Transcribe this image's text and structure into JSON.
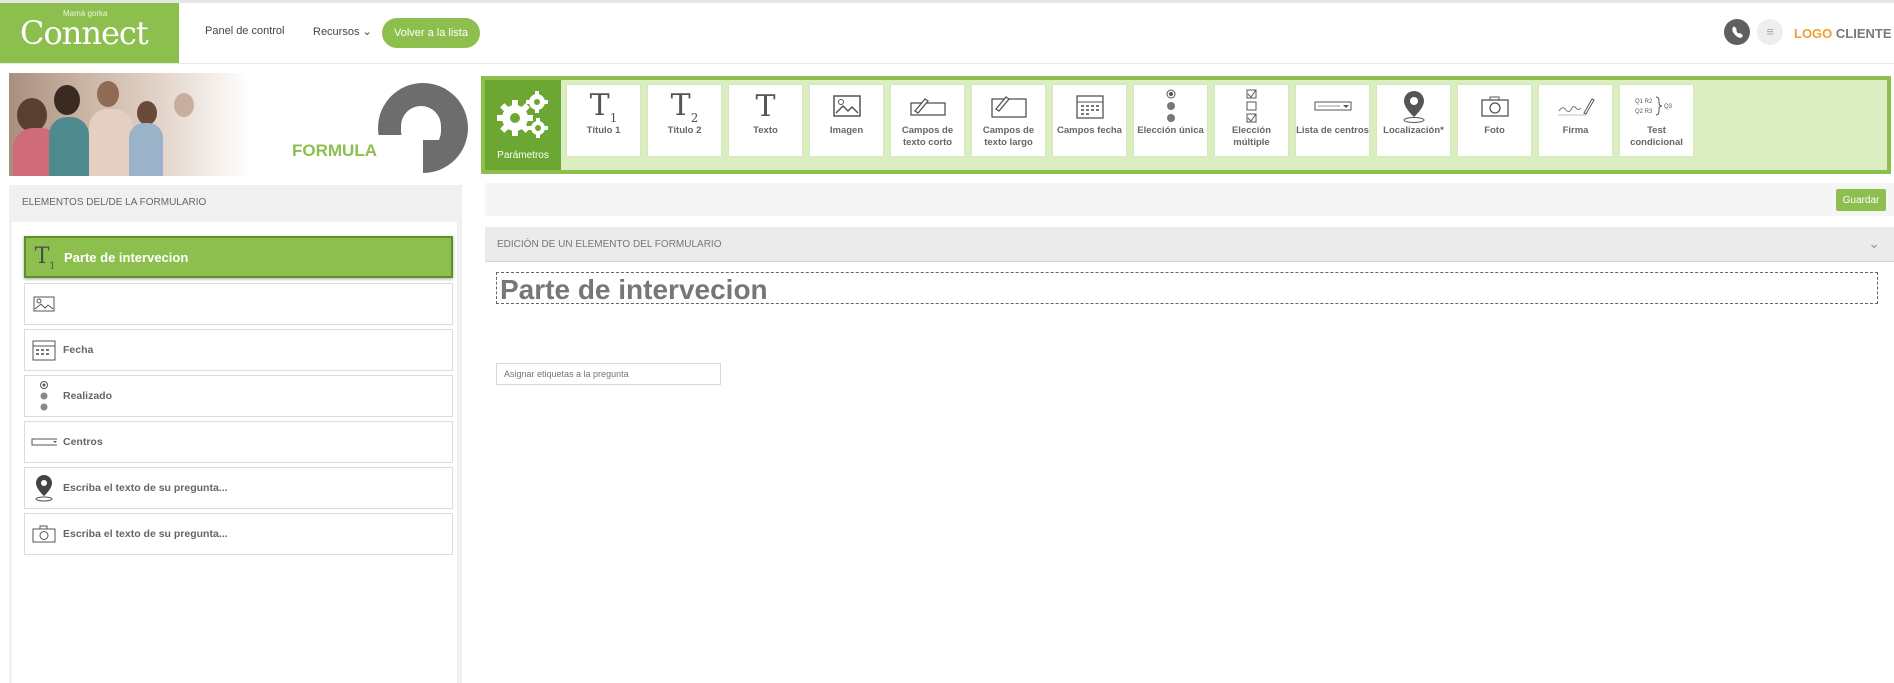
{
  "header": {
    "logo_small": "Mamá gorka",
    "logo_text": "Connect",
    "nav": {
      "dashboard": "Panel de control",
      "resources": "Recursos ⌄"
    },
    "back_button": "Volver a la lista",
    "client_logo": "LOGO CLIENTE"
  },
  "banner": {
    "title": "FORMULARIO"
  },
  "toolbar": {
    "params_label": "Parámetros",
    "tools": [
      {
        "label": "Título 1",
        "icon": "title1-icon"
      },
      {
        "label": "Título 2",
        "icon": "title2-icon"
      },
      {
        "label": "Texto",
        "icon": "text-icon"
      },
      {
        "label": "Imagen",
        "icon": "image-icon"
      },
      {
        "label": "Campos de texto corto",
        "icon": "short-text-icon"
      },
      {
        "label": "Campos de texto largo",
        "icon": "long-text-icon"
      },
      {
        "label": "Campos fecha",
        "icon": "calendar-icon"
      },
      {
        "label": "Elección única",
        "icon": "radio-icon"
      },
      {
        "label": "Elección múltiple",
        "icon": "checkbox-icon"
      },
      {
        "label": "Lista de centros",
        "icon": "dropdown-icon"
      },
      {
        "label": "Localización*",
        "icon": "location-pin-icon"
      },
      {
        "label": "Foto",
        "icon": "camera-icon"
      },
      {
        "label": "Firma",
        "icon": "signature-icon"
      },
      {
        "label": "Test condicional",
        "icon": "conditional-icon"
      }
    ]
  },
  "left": {
    "title": "ELEMENTOS DEL/DE LA FORMULARIO",
    "elements": [
      {
        "label": "Parte de intervecion",
        "icon": "title1-icon"
      },
      {
        "label": "",
        "icon": "image-icon"
      },
      {
        "label": "Fecha",
        "icon": "calendar-icon"
      },
      {
        "label": "Realizado",
        "icon": "radio-icon"
      },
      {
        "label": "Centros",
        "icon": "dropdown-icon"
      },
      {
        "label": "Escriba el texto de su pregunta...",
        "icon": "location-pin-icon"
      },
      {
        "label": "Escriba el texto de su pregunta...",
        "icon": "camera-icon"
      }
    ]
  },
  "right": {
    "save": "Guardar",
    "edit_title": "EDICIÓN DE UN ELEMENTO DEL FORMULARIO",
    "element_title": "Parte de intervecion",
    "tag_placeholder": "Asignar etiquetas a la pregunta"
  },
  "colors": {
    "brand_green": "#8cbf4e",
    "dark_green": "#6da733",
    "toolbar_bg": "#dbeec1"
  }
}
